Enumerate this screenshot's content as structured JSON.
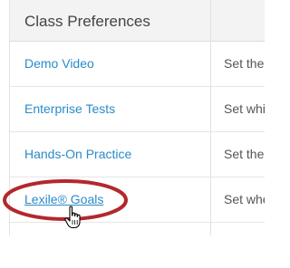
{
  "header": {
    "title": "Class Preferences"
  },
  "rows": [
    {
      "label": "Demo Video",
      "desc": "Set the"
    },
    {
      "label": "Enterprise Tests",
      "desc": "Set whi"
    },
    {
      "label": "Hands-On Practice",
      "desc": "Set the"
    },
    {
      "label": "Lexile® Goals",
      "desc": "Set whe"
    }
  ],
  "colors": {
    "link": "#2a8bc8",
    "highlight_ring": "#b3282c",
    "header_bg": "#f3f3f3"
  },
  "icons": {
    "cursor": "hand-pointer-icon"
  }
}
